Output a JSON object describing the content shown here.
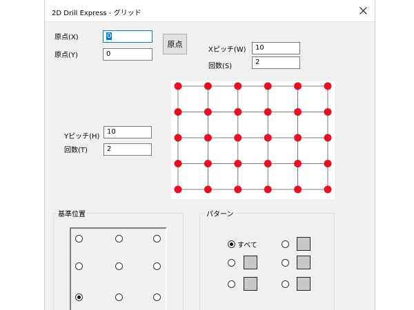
{
  "window": {
    "title": "2D Drill Express - グリッド",
    "close_icon": "close-icon"
  },
  "origin": {
    "x_label": "原点(X)",
    "x_value": "0",
    "y_label": "原点(Y)",
    "y_value": "0",
    "button_label": "原点"
  },
  "pitch_x": {
    "label": "Xピッチ(W)",
    "value": "10",
    "count_label": "回数(S)",
    "count_value": "2"
  },
  "pitch_y": {
    "label": "Yピッチ(H)",
    "value": "10",
    "count_label": "回数(T)",
    "count_value": "2"
  },
  "grid_preview": {
    "columns": 6,
    "rows": 5,
    "dot_color": "#e81123",
    "line_color": "#555555"
  },
  "reference_position": {
    "title": "基準位置",
    "selected_index": 6
  },
  "pattern": {
    "title": "パターン",
    "all_label": "すべて",
    "selected": "all"
  }
}
